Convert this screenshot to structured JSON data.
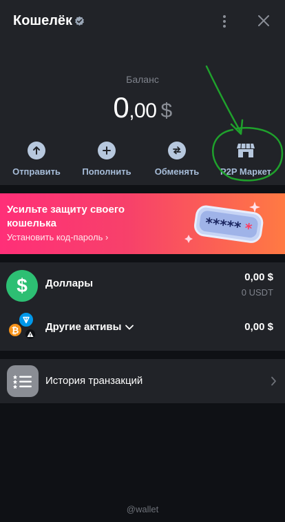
{
  "header": {
    "title": "Кошелёк",
    "balance_label": "Баланс",
    "balance_int": "0",
    "balance_dec": ",00",
    "balance_currency": "$"
  },
  "actions": [
    {
      "label": "Отправить",
      "icon": "arrow-up-icon"
    },
    {
      "label": "Пополнить",
      "icon": "plus-icon"
    },
    {
      "label": "Обменять",
      "icon": "swap-icon"
    },
    {
      "label": "P2P Маркет",
      "icon": "store-icon"
    }
  ],
  "banner": {
    "title": "Усильте защиту своего кошелька",
    "link": "Установить код-пароль",
    "art_text": "*****"
  },
  "assets": [
    {
      "name": "Доллары",
      "amount": "0,00 $",
      "sub": "0 USDT"
    },
    {
      "name": "Другие активы",
      "amount": "0,00 $"
    }
  ],
  "history": {
    "label": "История транзакций"
  },
  "footer": "@wallet",
  "colors": {
    "background": "#0f1115",
    "panel": "#212328",
    "action_label": "#a7bdd9",
    "action_circle": "#b7c8de",
    "banner_start": "#ff2f78",
    "banner_end": "#ff7a43",
    "usd_green": "#2dbf73",
    "annotation_green": "#1fa12c"
  }
}
